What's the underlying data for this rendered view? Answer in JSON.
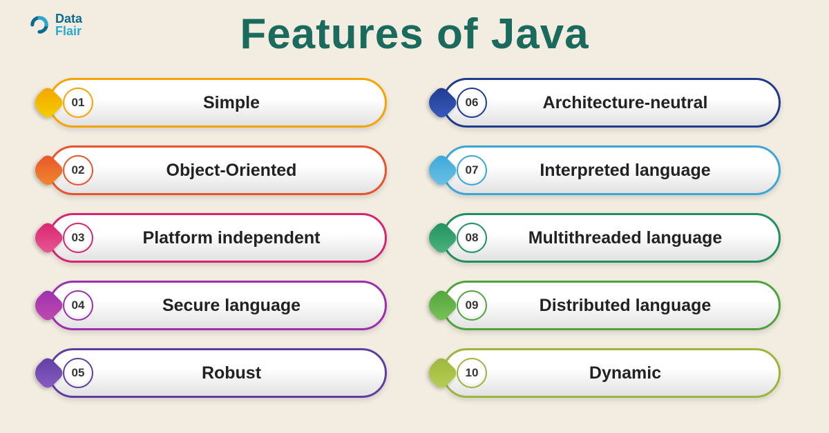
{
  "brand": {
    "line1": "Data",
    "line2": "Flair"
  },
  "title": "Features of Java",
  "items": [
    {
      "num": "01",
      "label": "Simple",
      "c1": "#f5a300",
      "c2": "#f3d000"
    },
    {
      "num": "02",
      "label": "Object-Oriented",
      "c1": "#e8532b",
      "c2": "#f08a2c"
    },
    {
      "num": "03",
      "label": "Platform independent",
      "c1": "#d8236f",
      "c2": "#e85a94"
    },
    {
      "num": "04",
      "label": "Secure language",
      "c1": "#9b2fae",
      "c2": "#c24bb0"
    },
    {
      "num": "05",
      "label": "Robust",
      "c1": "#5f3da0",
      "c2": "#8a5fc4"
    },
    {
      "num": "06",
      "label": "Architecture-neutral",
      "c1": "#1e3a8c",
      "c2": "#3a5cc0"
    },
    {
      "num": "07",
      "label": "Interpreted language",
      "c1": "#3aa6d6",
      "c2": "#6ec3e6"
    },
    {
      "num": "08",
      "label": "Multithreaded language",
      "c1": "#1f8f5f",
      "c2": "#4fb57f"
    },
    {
      "num": "09",
      "label": "Distributed language",
      "c1": "#4fa33b",
      "c2": "#7cc45a"
    },
    {
      "num": "10",
      "label": "Dynamic",
      "c1": "#9cb53a",
      "c2": "#b8cf56"
    }
  ]
}
